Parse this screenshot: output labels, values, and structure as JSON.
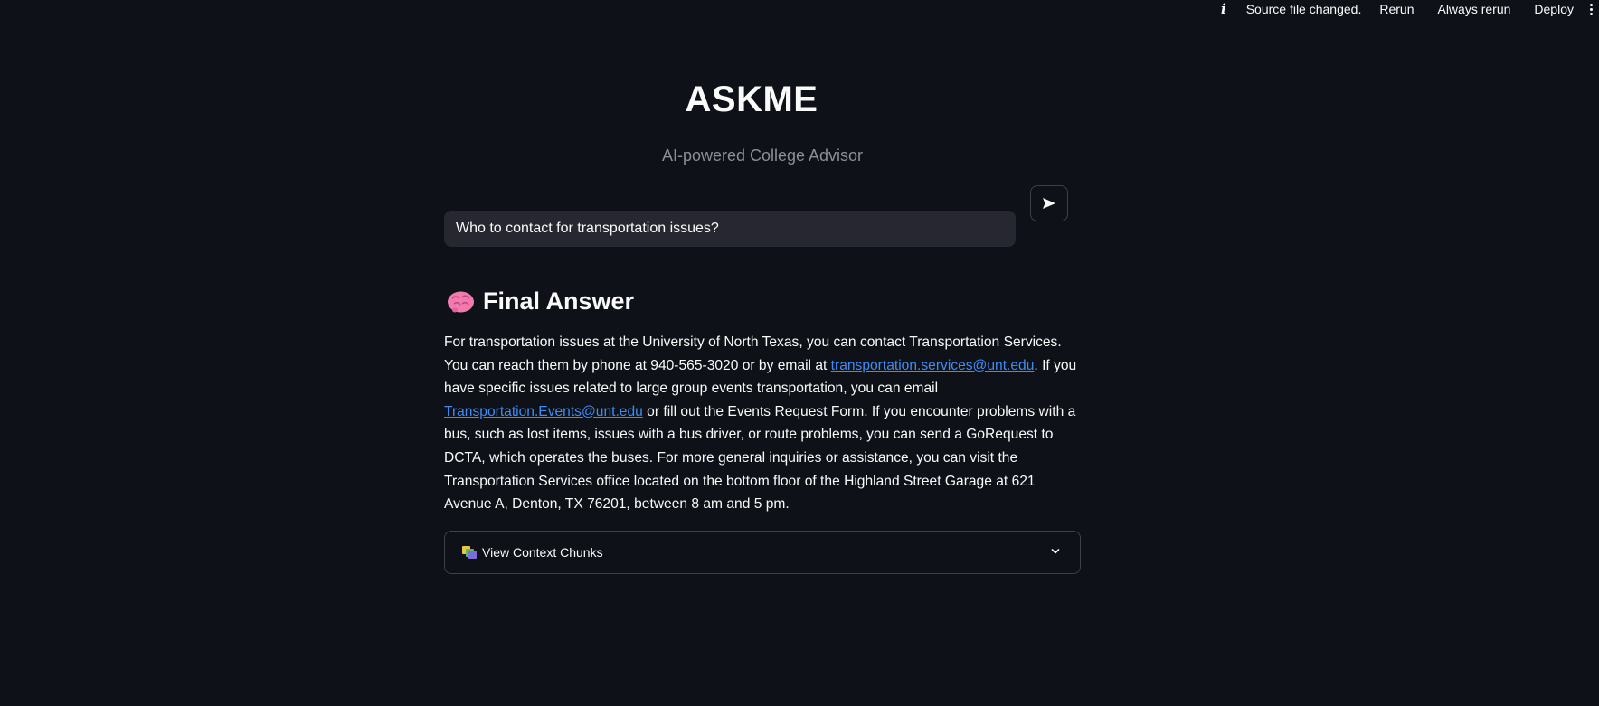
{
  "topbar": {
    "status": "Source file changed.",
    "rerun_label": "Rerun",
    "always_rerun_label": "Always rerun",
    "deploy_label": "Deploy"
  },
  "header": {
    "title": "ASKME",
    "subtitle": "AI-powered College Advisor"
  },
  "query": {
    "value": "Who to contact for transportation issues?",
    "send_icon": "send-arrow-icon"
  },
  "answer": {
    "heading": "Final Answer",
    "heading_icon": "brain-icon",
    "segments": {
      "part1": "For transportation issues at the University of North Texas, you can contact Transportation Services. You can reach them by phone at 940-565-3020 or by email at ",
      "link1": "transportation.services@unt.edu",
      "part2": ". If you have specific issues related to large group events transportation, you can email ",
      "link2": "Transportation.Events@unt.edu",
      "part3": " or fill out the Events Request Form. If you encounter problems with a bus, such as lost items, issues with a bus driver, or route problems, you can send a GoRequest to DCTA, which operates the buses. For more general inquiries or assistance, you can visit the Transportation Services office located on the bottom floor of the Highland Street Garage at 621 Avenue A, Denton, TX 76201, between 8 am and 5 pm."
    }
  },
  "expander": {
    "label": "View Context Chunks",
    "icon": "books-icon",
    "expanded": false
  },
  "colors": {
    "background": "#0e1117",
    "input_bg": "#262730",
    "link": "#3f8cf5",
    "subtitle": "#8c8f96"
  }
}
